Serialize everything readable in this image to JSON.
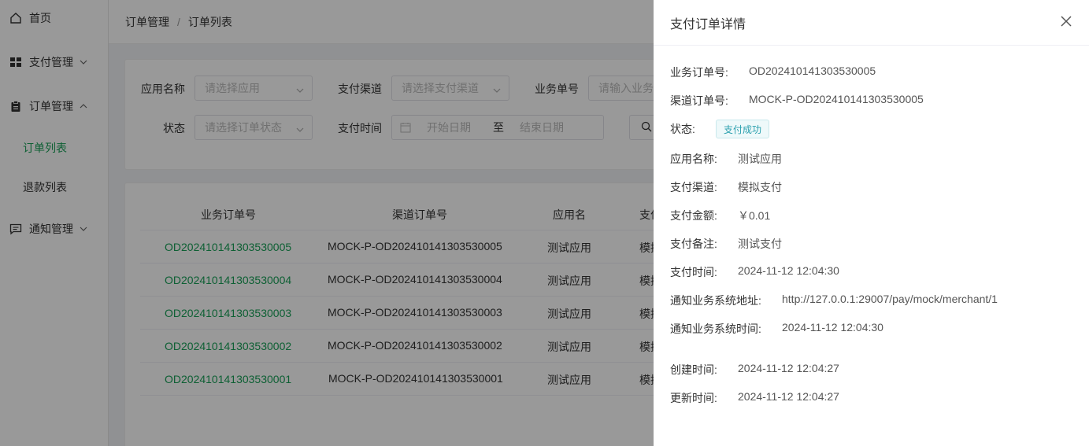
{
  "sidebar": {
    "home": "首页",
    "pay_mgmt": "支付管理",
    "order_mgmt": "订单管理",
    "order_list": "订单列表",
    "refund_list": "退款列表",
    "notify_mgmt": "通知管理"
  },
  "breadcrumb": {
    "first": "订单管理",
    "separator": "/",
    "second": "订单列表"
  },
  "search": {
    "app_label": "应用名称",
    "app_placeholder": "请选择应用",
    "channel_label": "支付渠道",
    "channel_placeholder": "请选择支付渠道",
    "bizno_label": "业务单号",
    "bizno_placeholder": "请输入业务",
    "status_label": "状态",
    "status_placeholder": "请选择订单状态",
    "paytime_label": "支付时间",
    "start_placeholder": "开始日期",
    "range_sep": "至",
    "end_placeholder": "结束日期"
  },
  "table": {
    "headers": [
      "业务订单号",
      "渠道订单号",
      "应用名",
      "支付"
    ],
    "rows": [
      {
        "biz": "OD202410141303530005",
        "channel": "MOCK-P-OD202410141303530005",
        "app": "测试应用",
        "pay": "模拟"
      },
      {
        "biz": "OD202410141303530004",
        "channel": "MOCK-P-OD202410141303530004",
        "app": "测试应用",
        "pay": "模拟"
      },
      {
        "biz": "OD202410141303530003",
        "channel": "MOCK-P-OD202410141303530003",
        "app": "测试应用",
        "pay": "模拟"
      },
      {
        "biz": "OD202410141303530002",
        "channel": "MOCK-P-OD202410141303530002",
        "app": "测试应用",
        "pay": "模拟"
      },
      {
        "biz": "OD202410141303530001",
        "channel": "MOCK-P-OD202410141303530001",
        "app": "测试应用",
        "pay": "模拟"
      }
    ]
  },
  "drawer": {
    "title": "支付订单详情",
    "fields": {
      "biz_label": "业务订单号:",
      "biz_value": "OD202410141303530005",
      "channel_label": "渠道订单号:",
      "channel_value": "MOCK-P-OD202410141303530005",
      "status_label": "状态:",
      "status_value": "支付成功",
      "app_label": "应用名称:",
      "app_value": "测试应用",
      "paych_label": "支付渠道:",
      "paych_value": "模拟支付",
      "amount_label": "支付金额:",
      "amount_value": "￥0.01",
      "remark_label": "支付备注:",
      "remark_value": "测试支付",
      "paytime_label": "支付时间:",
      "paytime_value": "2024-11-12 12:04:30",
      "notifyurl_label": "通知业务系统地址:",
      "notifyurl_value": "http://127.0.0.1:29007/pay/mock/merchant/1",
      "notifytime_label": "通知业务系统时间:",
      "notifytime_value": "2024-11-12 12:04:30",
      "created_label": "创建时间:",
      "created_value": "2024-11-12 12:04:27",
      "updated_label": "更新时间:",
      "updated_value": "2024-11-12 12:04:27"
    }
  },
  "colors": {
    "accent": "#18a058",
    "tag_text": "#2aa0ae",
    "overlay": "rgba(0,0,0,0.40)"
  }
}
